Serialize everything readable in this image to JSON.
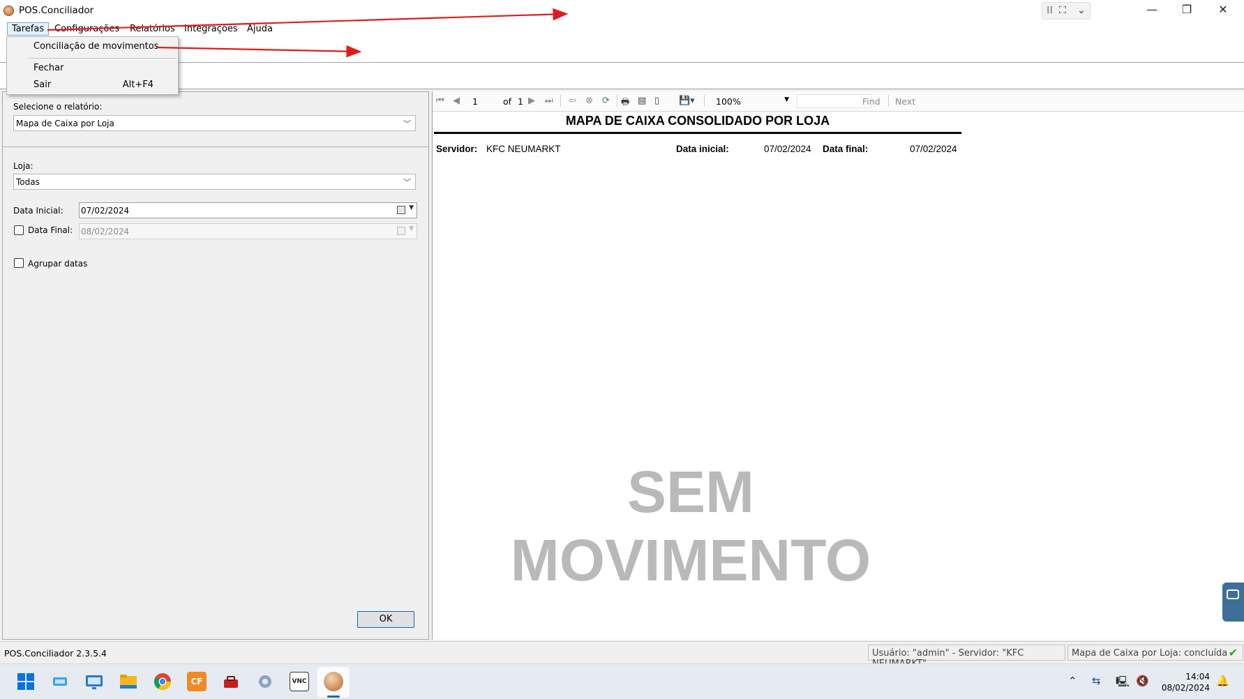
{
  "window": {
    "title": "POS.Conciliador",
    "minimize_glyph": "—",
    "restore_glyph": "❐",
    "close_glyph": "✕",
    "snap_icons": [
      "grip-icon",
      "expand-icon",
      "chevron-down-icon"
    ]
  },
  "menubar": {
    "items": [
      "Tarefas",
      "Configurações",
      "Relatórios",
      "Integrações",
      "Ajuda"
    ]
  },
  "tarefas_menu": {
    "items": [
      {
        "label": "Conciliação de movimentos",
        "shortcut": ""
      },
      {
        "label": "Fechar",
        "shortcut": ""
      },
      {
        "label": "Sair",
        "shortcut": "Alt+F4"
      }
    ]
  },
  "left_panel": {
    "report_label": "Selecione o relatório:",
    "report_value": "Mapa de Caixa por Loja",
    "loja_label": "Loja:",
    "loja_value": "Todas",
    "data_inicial_label": "Data Inicial:",
    "data_inicial_value": "07/02/2024",
    "data_final_label": "Data Final:",
    "data_final_value": "08/02/2024",
    "data_final_checked": false,
    "agrupar_label": "Agrupar datas",
    "agrupar_checked": false,
    "ok_label": "OK"
  },
  "viewer_toolbar": {
    "page_current": "1",
    "page_of_label": "of",
    "page_total": "1",
    "zoom": "100%",
    "find_label": "Find",
    "next_label": "Next"
  },
  "report": {
    "title": "MAPA DE CAIXA CONSOLIDADO POR LOJA",
    "servidor_label": "Servidor:",
    "servidor_value": "KFC NEUMARKT",
    "data_inicial_label": "Data inicial:",
    "data_inicial_value": "07/02/2024",
    "data_final_label": "Data final:",
    "data_final_value": "07/02/2024",
    "watermark_line1": "SEM",
    "watermark_line2": "MOVIMENTO"
  },
  "statusbar": {
    "version": "POS.Conciliador 2.3.5.4",
    "user_info": "Usuário: \"admin\" - Servidor: \"KFC NEUMARKT\"",
    "report_status": "Mapa de Caixa por Loja: concluída",
    "status_glyph": "✔"
  },
  "taskbar": {
    "apps": [
      "start-icon",
      "desktop-icon",
      "remote-desktop-icon",
      "file-explorer-icon",
      "chrome-icon",
      "cf-app-icon",
      "toolbox-icon",
      "settings-gear-icon",
      "vnc-icon",
      "pos-conciliador-icon"
    ],
    "cf_label": "CF",
    "vnc_label": "VNC",
    "time": "14:04",
    "date": "08/02/2024"
  },
  "colors": {
    "annotation_arrow": "#e01b1b",
    "accent_blue": "#1766c7",
    "watermark_gray": "#b9b9b9",
    "status_ok_green": "#2fa12f"
  }
}
